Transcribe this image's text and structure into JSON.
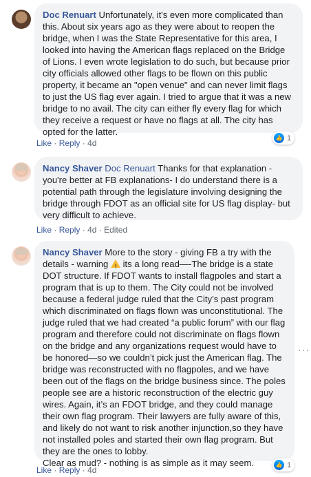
{
  "comments": [
    {
      "author": "Doc Renuart",
      "text": "Unfortunately, it's even more complicated than this. About six years ago as they were about to reopen the bridge, when I was the State Representative for this area, I looked into having the American flags replaced on the Bridge of Lions. I even wrote legislation to do such, but because prior city officials allowed other flags to be flown on this public property, it became an \"open venue\" and can never limit flags to just the US flag ever again. I tried to argue that it was a new bridge to no avail. The city can either fly every flag for which they receive a request or have no flags at all. The city has opted for the latter.",
      "like": "Like",
      "reply": "Reply",
      "time": "4d",
      "reaction_count": "1"
    },
    {
      "author": "Nancy Shaver",
      "mention": "Doc Renuart",
      "text": "Thanks for that explanation - you're better at FB explanations- I do understand there is a potential path through the legislature involving designing the bridge through FDOT as an official site for US flag display- but very difficult to achieve.",
      "like": "Like",
      "reply": "Reply",
      "time": "4d",
      "edited": "Edited"
    },
    {
      "author": "Nancy Shaver",
      "text_before": "More to the story - giving FB a try with the details - warning",
      "text_after": "its a long read—-The bridge is a state DOT structure. If FDOT wants to install flagpoles and start a program that is up to them. The City could not be involved because a federal judge ruled that the City’s past program which discriminated on flags flown was unconstitutional. The judge ruled that we had created “a public forum” with our flag program and therefore could not discriminate on flags flown on the bridge and any organizations request would have to be honored—so we couldn’t pick just the American flag. The bridge was reconstructed with no flagpoles, and we have been out of the flags on the bridge business since. The poles people see are a historic reconstruction of the electric guy wires. Again, it’s an FDOT bridge, and they could manage their own flag program. Their lawyers are fully aware of this, and likely do not want to risk another injunction,so they have not installed poles and started their own flag program. But they are the ones to lobby.",
      "text_last": "Clear as mud? - nothing is as simple as it may seem.",
      "like": "Like",
      "reply": "Reply",
      "time": "4d",
      "reaction_count": "1"
    }
  ],
  "separator": "·",
  "more_glyph": "···",
  "icons": [
    "avatar",
    "like-thumb-icon",
    "warning-icon",
    "more-options-icon"
  ],
  "colors": {
    "name": "#385898",
    "bubble": "#f2f3f5",
    "like": "#1877f2"
  }
}
